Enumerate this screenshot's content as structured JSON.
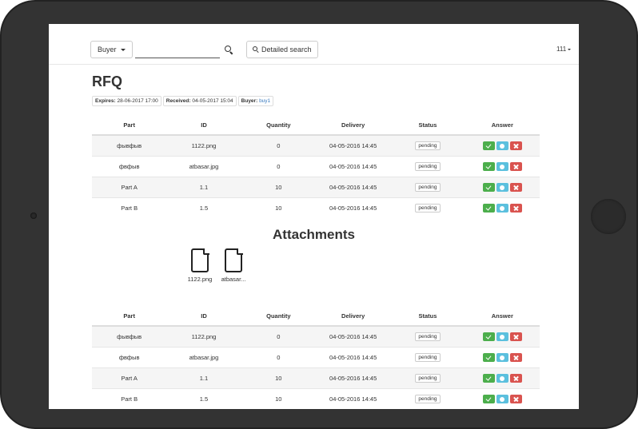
{
  "navbar": {
    "buyer_label": "Buyer",
    "search_placeholder": "",
    "detailed_search_label": "Detailed search",
    "user_label": "111"
  },
  "page": {
    "title": "RFQ"
  },
  "meta": {
    "expires_label": "Expires:",
    "expires_value": "28-06-2017 17:00",
    "received_label": "Received:",
    "received_value": "04-05-2017 15:04",
    "buyer_label": "Buyer:",
    "buyer_value": "buy1"
  },
  "table": {
    "headers": [
      "Part",
      "ID",
      "Quantity",
      "Delivery",
      "Status",
      "Answer"
    ],
    "rows": [
      {
        "part": "фывфыв",
        "id": "1122.png",
        "quantity": "0",
        "delivery": "04-05-2016 14:45",
        "status": "pending"
      },
      {
        "part": "фвфыв",
        "id": "atbasar.jpg",
        "quantity": "0",
        "delivery": "04-05-2016 14:45",
        "status": "pending"
      },
      {
        "part": "Part A",
        "id": "1.1",
        "quantity": "10",
        "delivery": "04-05-2016 14:45",
        "status": "pending"
      },
      {
        "part": "Part B",
        "id": "1.5",
        "quantity": "10",
        "delivery": "04-05-2016 14:45",
        "status": "pending"
      }
    ]
  },
  "attachments": {
    "title": "Attachments",
    "files": [
      {
        "name": "1122.png",
        "icon": "file-icon"
      },
      {
        "name": "atbasar...",
        "icon": "file-icon"
      }
    ]
  },
  "table2": {
    "headers": [
      "Part",
      "ID",
      "Quantity",
      "Delivery",
      "Status",
      "Answer"
    ],
    "rows": [
      {
        "part": "фывфыв",
        "id": "1122.png",
        "quantity": "0",
        "delivery": "04-05-2016 14:45",
        "status": "pending"
      },
      {
        "part": "фвфыв",
        "id": "atbasar.jpg",
        "quantity": "0",
        "delivery": "04-05-2016 14:45",
        "status": "pending"
      },
      {
        "part": "Part A",
        "id": "1.1",
        "quantity": "10",
        "delivery": "04-05-2016 14:45",
        "status": "pending"
      },
      {
        "part": "Part B",
        "id": "1.5",
        "quantity": "10",
        "delivery": "04-05-2016 14:45",
        "status": "pending"
      }
    ]
  },
  "colors": {
    "accept": "#4cae4c",
    "info": "#5bc0de",
    "reject": "#d9534f",
    "link": "#3a7bbf",
    "bezel": "#333333"
  },
  "icons": {
    "accept": "check-icon",
    "info": "question-icon",
    "reject": "close-icon",
    "search": "search-icon"
  }
}
